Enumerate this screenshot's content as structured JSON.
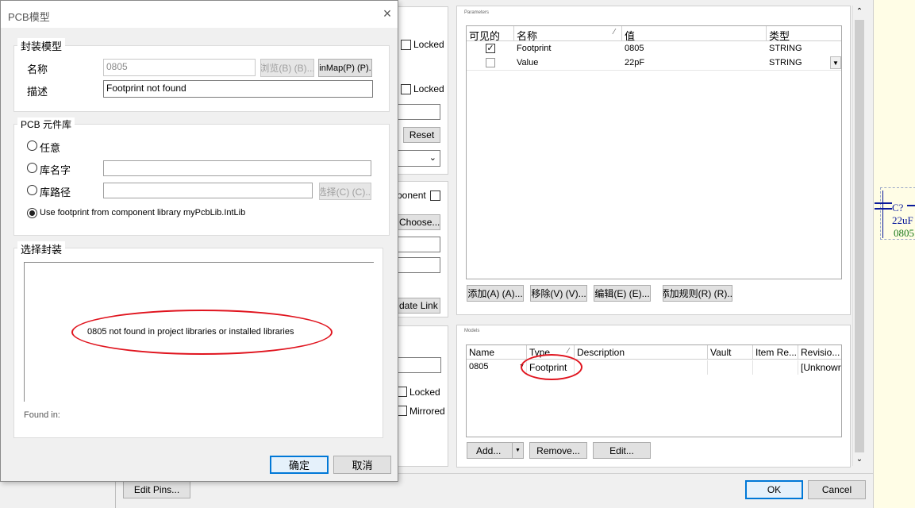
{
  "pcb_dialog": {
    "title": "PCB模型",
    "footprint_group_title": "封装模型",
    "name_label": "名称",
    "name_value": "0805",
    "browse_button": "浏览(B) (B)...",
    "pinmap_button": "inMap(P) (P).",
    "description_label": "描述",
    "description_value": "Footprint not found",
    "library_group_title": "PCB 元件库",
    "radio_any": "任意",
    "radio_lib_name": "库名字",
    "radio_lib_path": "库路径",
    "select_button": "选择(C) (C)...",
    "radio_use_component_lib": "Use footprint from component library myPcbLib.IntLib",
    "select_footprint_group_title": "选择封装",
    "not_found_message": "0805 not found in project libraries or installed libraries",
    "found_in_label": "Found in:",
    "ok_button": "确定",
    "cancel_button": "取消"
  },
  "behind_dialog": {
    "locked_1": "Locked",
    "locked_2": "Locked",
    "reset_button": "Reset",
    "component_checkbox_label": "ponent",
    "choose_button": "Choose...",
    "update_link_button": "date Link",
    "locked_3": "Locked",
    "mirrored": "Mirrored",
    "edit_pins_button": "Edit Pins...",
    "ok_button": "OK",
    "cancel_button": "Cancel"
  },
  "parameters": {
    "section_title": "Parameters",
    "columns": [
      "可见的",
      "名称",
      "值",
      "类型"
    ],
    "rows": [
      {
        "visible": true,
        "name": "Footprint",
        "value": "0805",
        "type": "STRING"
      },
      {
        "visible": false,
        "name": "Value",
        "value": "22pF",
        "type": "STRING"
      }
    ],
    "add_button": "添加(A) (A)...",
    "remove_button": "移除(V) (V)...",
    "edit_button": "编辑(E) (E)...",
    "add_rule_button": "添加规则(R) (R)..."
  },
  "models": {
    "section_title": "Models",
    "columns": [
      "Name",
      "Type",
      "Description",
      "Vault",
      "Item Re...",
      "Revisio..."
    ],
    "rows": [
      {
        "name": "0805",
        "type": "Footprint",
        "description": "",
        "vault": "",
        "item_rev": "",
        "revision": "[Unknowr"
      }
    ],
    "add_button": "Add...",
    "remove_button": "Remove...",
    "edit_button": "Edit..."
  },
  "schematic": {
    "designator": "C?",
    "value": "22uF",
    "footprint": "0805"
  },
  "colors": {
    "highlight_ellipse": "#e0141e",
    "primary_button_border": "#0078d7",
    "schematic_blue": "#0a1a9c",
    "schematic_green": "#1a7a1a"
  }
}
